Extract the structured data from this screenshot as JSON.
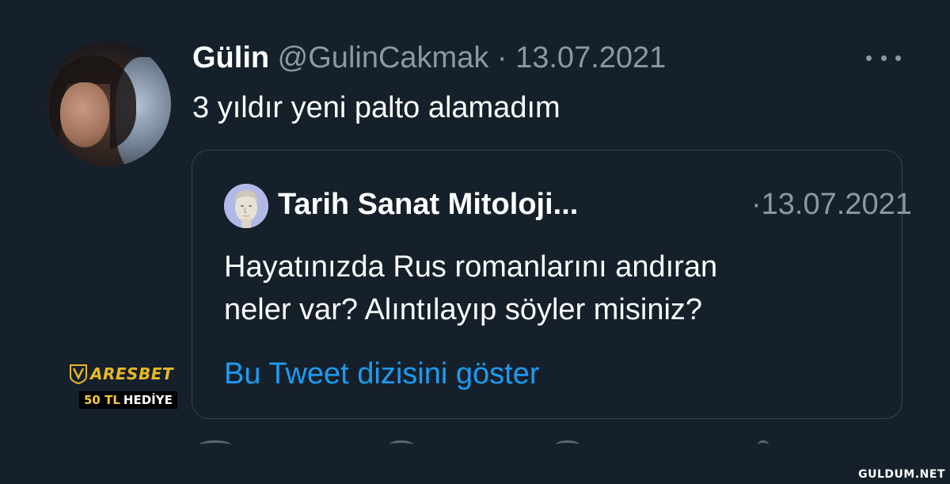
{
  "tweet": {
    "author_name": "Gülin",
    "handle": "@GulinCakmak",
    "separator": "·",
    "date": "13.07.2021",
    "text": "3 yıldır yeni palto alamadım",
    "more_icon": "more-horizontal-icon"
  },
  "quoted_tweet": {
    "author_name": "Tarih Sanat Mitoloji...",
    "separator": "·",
    "date": "13.07.2021",
    "text_line1": "Hayatınızda Rus romanlarını andıran",
    "text_line2": "neler var? Alıntılayıp söyler misiniz?",
    "show_thread_link": "Bu Tweet dizisini göster"
  },
  "promo": {
    "brand": "ARESBET",
    "amount": "50 TL",
    "label": "HEDİYE"
  },
  "watermark": "GULDUM.NET",
  "colors": {
    "background": "#15202b",
    "text_primary": "#ffffff",
    "text_secondary": "#8b98a5",
    "link": "#1d9bf0",
    "border": "#38444d",
    "promo_gold": "#e8b923"
  }
}
